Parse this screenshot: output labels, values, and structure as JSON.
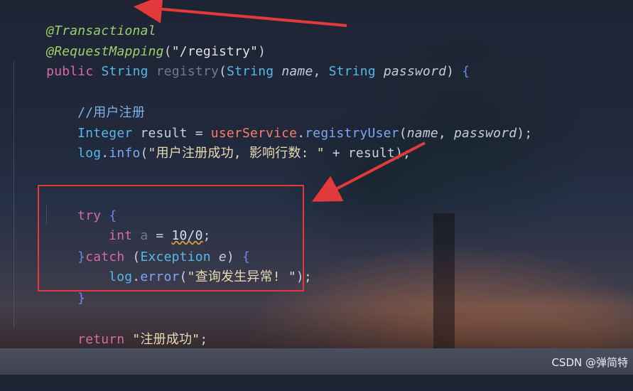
{
  "code": {
    "l1": {
      "annotation": "@Transactional"
    },
    "l2": {
      "annotation": "@RequestMapping",
      "open": "(",
      "path": "\"/registry\"",
      "close": ")"
    },
    "l3": {
      "kw": "public",
      "type": "String",
      "method": "registry",
      "open": "(",
      "t1": "String",
      "p1": "name",
      "comma": ", ",
      "t2": "String",
      "p2": "password",
      "close": ")",
      "brace": " {"
    },
    "l5": {
      "comment": "//用户注册"
    },
    "l6": {
      "type": "Integer",
      "rest": " result = ",
      "svc": "userService",
      "dot": ".",
      "call": "registryUser",
      "open": "(",
      "a1": "name",
      "comma": ", ",
      "a2": "password",
      "close": ");"
    },
    "l7": {
      "obj": "log",
      "dot": ".",
      "call": "info",
      "open": "(",
      "str": "\"用户注册成功, 影响行数: \"",
      "rest": " + result);"
    },
    "l10": {
      "kw": "try",
      "brace": " {"
    },
    "l11": {
      "kw": "int",
      "var": " a",
      "eq": " = ",
      "num": "10/0",
      "end": ";"
    },
    "l12": {
      "brace1": "}",
      "kw": "catch",
      "open": " (",
      "type": "Exception",
      "var": " e",
      "close": ")",
      "brace2": " {"
    },
    "l13": {
      "obj": "log",
      "dot": ".",
      "call": "error",
      "open": "(",
      "str": "\"查询发生异常! \"",
      "close": ");"
    },
    "l14": {
      "brace": "}"
    },
    "l16": {
      "kw": "return",
      "str": " \"注册成功\"",
      "end": ";"
    },
    "l17": {
      "brace": "}"
    }
  },
  "watermark": "CSDN @弹简特",
  "colors": {
    "annotation": "#9bcf6b",
    "keyword": "#d96aa0",
    "type": "#57b7e8",
    "highlight_box": "#e23a3a",
    "arrow": "#e23a3a"
  }
}
